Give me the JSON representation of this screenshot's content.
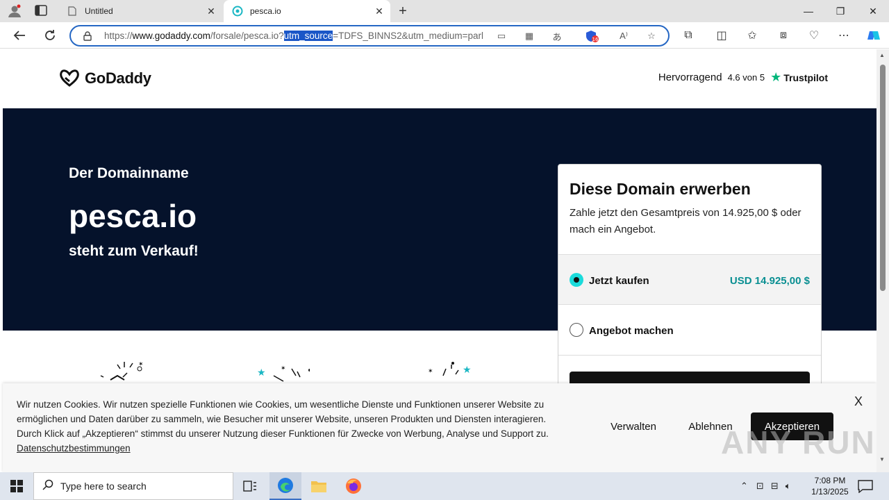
{
  "browser": {
    "tabs": [
      {
        "title": "Untitled",
        "active": false
      },
      {
        "title": "pesca.io",
        "active": true
      }
    ],
    "url": {
      "prefix": "https://",
      "domain": "www.godaddy.com",
      "path": "/forsale/pesca.io?",
      "selected": "utm_source",
      "rest": "=TDFS_BINNS2&utm_medium=parl"
    },
    "extension_badge": "16"
  },
  "site": {
    "logo_text": "GoDaddy",
    "trust_label": "Hervorragend",
    "trust_score": "4.6 von 5",
    "trust_brand": "Trustpilot"
  },
  "hero": {
    "pre": "Der Domainname",
    "domain": "pesca.io",
    "post": "steht zum Verkauf!"
  },
  "card": {
    "title": "Diese Domain erwerben",
    "description": "Zahle jetzt den Gesamtpreis von 14.925,00 $ oder mach ein Angebot.",
    "buy_label": "Jetzt kaufen",
    "buy_price": "USD 14.925,00 $",
    "offer_label": "Angebot machen",
    "selected_option": "buy"
  },
  "cookie": {
    "text": "Wir nutzen Cookies. Wir nutzen spezielle Funktionen wie Cookies, um wesentliche Dienste und Funktionen unserer Website zu ermöglichen und Daten darüber zu sammeln, wie Besucher mit unserer Website, unseren Produkten und Diensten interagieren. Durch Klick auf „Akzeptieren“ stimmst du unserer Nutzung dieser Funktionen für Zwecke von Werbung, Analyse und Support zu.",
    "link": "Datenschutzbestimmungen",
    "close": "X",
    "manage": "Verwalten",
    "decline": "Ablehnen",
    "accept": "Akzeptieren"
  },
  "watermark": "ANY RUN",
  "taskbar": {
    "search_placeholder": "Type here to search",
    "time": "7:08 PM",
    "date": "1/13/2025"
  },
  "colors": {
    "hero_bg": "#05122b",
    "accent_teal": "#1bdbdb",
    "price_teal": "#0a8f92",
    "address_border": "#2567c4"
  }
}
